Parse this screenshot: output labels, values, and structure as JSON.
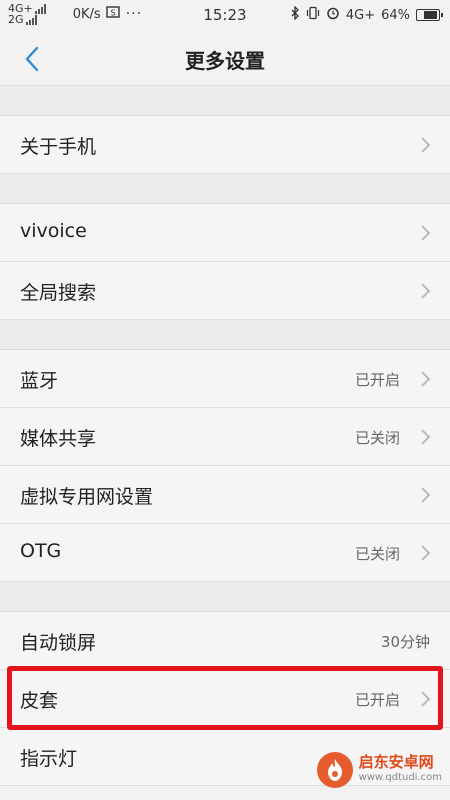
{
  "status_bar": {
    "network_top": "4G+",
    "network_bottom": "2G",
    "speed": "0K/s",
    "dots": "···",
    "time": "15:23",
    "right_network": "4G+",
    "battery_text": "64%",
    "battery_level": 0.64
  },
  "header": {
    "title": "更多设置"
  },
  "settings": {
    "about_phone": {
      "label": "关于手机"
    },
    "vivoice": {
      "label": "vivoice"
    },
    "global_search": {
      "label": "全局搜索"
    },
    "bluetooth": {
      "label": "蓝牙",
      "value": "已开启"
    },
    "media_share": {
      "label": "媒体共享",
      "value": "已关闭"
    },
    "vpn": {
      "label": "虚拟专用网设置"
    },
    "otg": {
      "label": "OTG",
      "value": "已关闭"
    },
    "auto_lock": {
      "label": "自动锁屏",
      "value": "30分钟"
    },
    "case": {
      "label": "皮套",
      "value": "已开启"
    },
    "indicator": {
      "label": "指示灯"
    }
  },
  "highlight_color": "#e3151a",
  "watermark": {
    "title": "启东安卓网",
    "url": "www.qdtudi.com",
    "logo_icon": "flame-icon"
  }
}
